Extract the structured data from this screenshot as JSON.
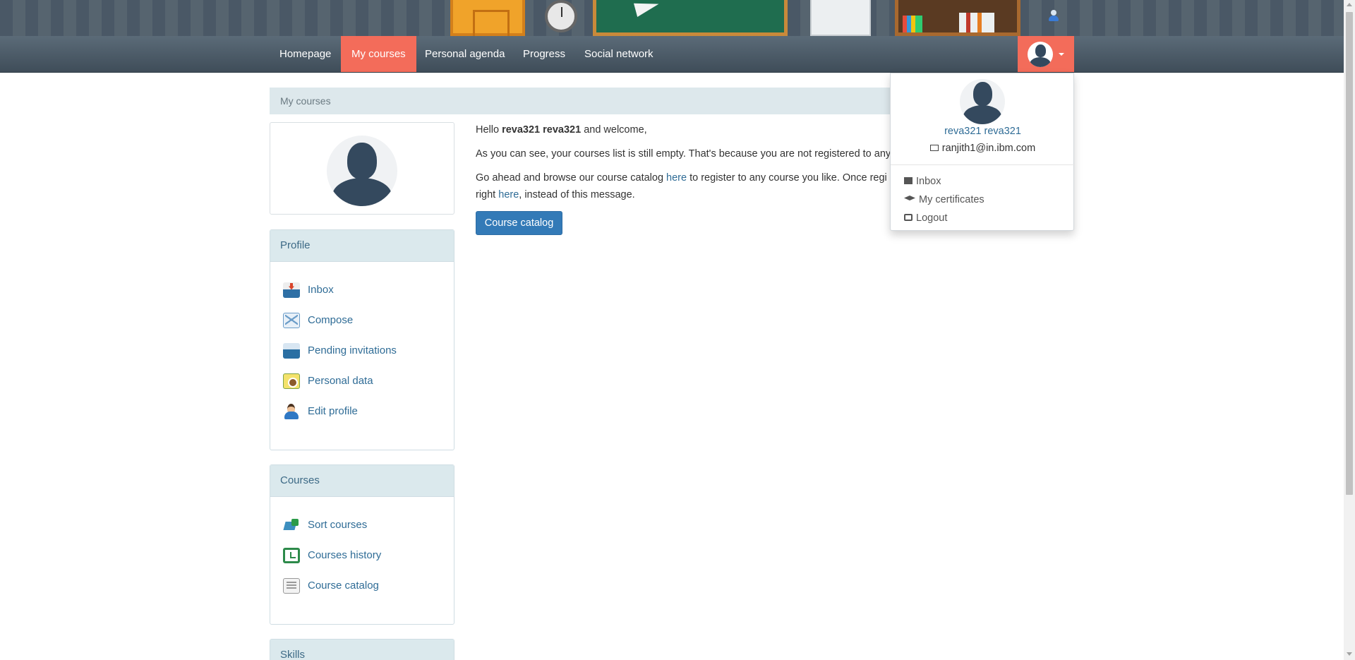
{
  "navbar": {
    "items": [
      {
        "label": "Homepage"
      },
      {
        "label": "My courses",
        "active": true
      },
      {
        "label": "Personal agenda"
      },
      {
        "label": "Progress"
      },
      {
        "label": "Social network"
      }
    ]
  },
  "breadcrumb": {
    "current": "My courses"
  },
  "profile_panel": {
    "title": "Profile",
    "links": [
      {
        "label": "Inbox",
        "icon": "inbox-icon"
      },
      {
        "label": "Compose",
        "icon": "compose-icon"
      },
      {
        "label": "Pending invitations",
        "icon": "pending-invitations-icon"
      },
      {
        "label": "Personal data",
        "icon": "personal-data-icon"
      },
      {
        "label": "Edit profile",
        "icon": "edit-profile-icon"
      }
    ]
  },
  "courses_panel": {
    "title": "Courses",
    "links": [
      {
        "label": "Sort courses",
        "icon": "sort-courses-icon"
      },
      {
        "label": "Courses history",
        "icon": "courses-history-icon"
      },
      {
        "label": "Course catalog",
        "icon": "course-catalog-icon"
      }
    ]
  },
  "skills_panel": {
    "title": "Skills"
  },
  "welcome": {
    "hello": "Hello",
    "username": "reva321 reva321",
    "welcome_suffix": "and welcome,",
    "empty_line": "As you can see, your courses list is still empty. That's because you are not registered to any",
    "browse_prefix": "Go ahead and browse our course catalog",
    "here_link": "here",
    "browse_suffix": "to register to any course you like. Once regi",
    "right_prefix": "right",
    "here_link2": "here",
    "right_suffix": ", instead of this message."
  },
  "course_catalog_button": "Course catalog",
  "user_dropdown": {
    "name": "reva321 reva321",
    "email": "ranjith1@in.ibm.com",
    "items": [
      {
        "label": "Inbox",
        "icon": "envelope-icon"
      },
      {
        "label": "My certificates",
        "icon": "graduation-cap-icon"
      },
      {
        "label": "Logout",
        "icon": "sign-out-icon"
      }
    ]
  },
  "colors": {
    "accent": "#f36c5a",
    "link": "#2f6c96",
    "primary_button": "#337ab7",
    "panel_heading": "#dbe9ed",
    "avatar": "#34495e"
  }
}
